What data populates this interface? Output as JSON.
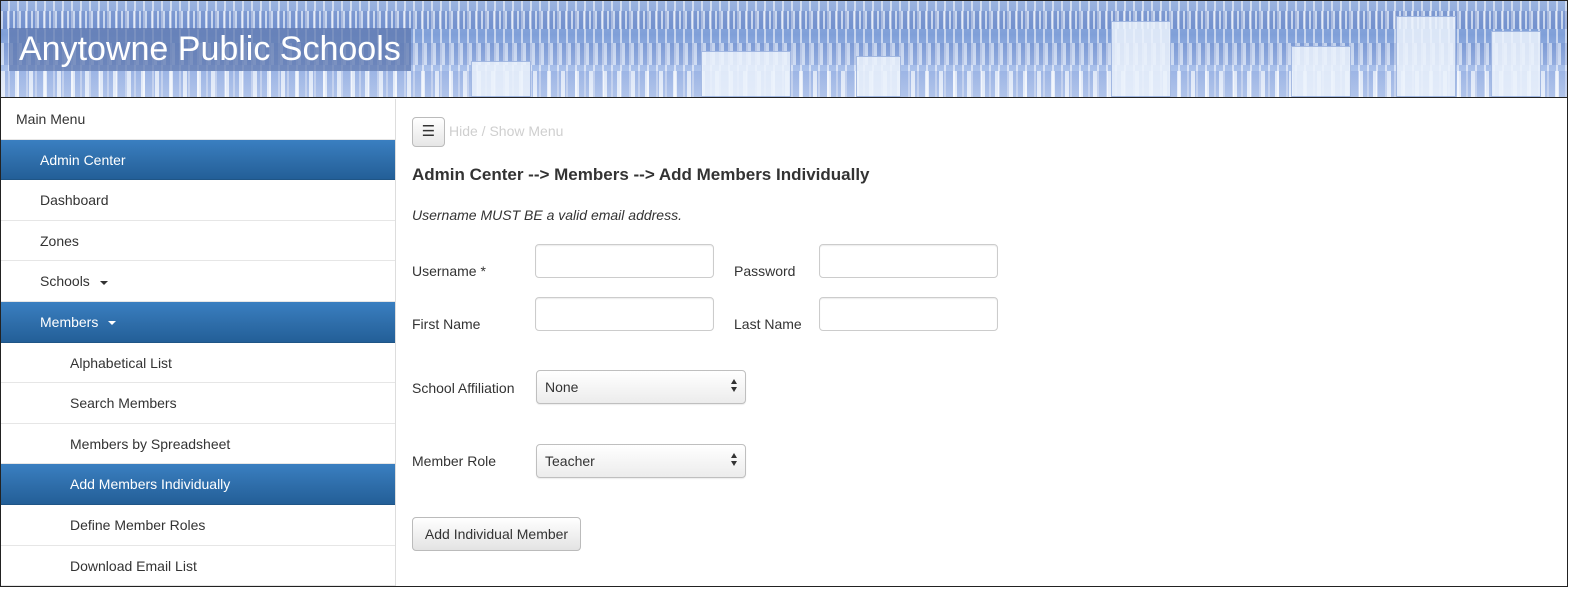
{
  "header": {
    "title": "Anytowne Public Schools"
  },
  "sidebar": {
    "items": [
      {
        "label": "Main Menu"
      },
      {
        "label": "Admin Center"
      },
      {
        "label": "Dashboard"
      },
      {
        "label": "Zones"
      },
      {
        "label": "Schools"
      },
      {
        "label": "Members"
      },
      {
        "label": "Alphabetical List"
      },
      {
        "label": "Search Members"
      },
      {
        "label": "Members by Spreadsheet"
      },
      {
        "label": "Add Members Individually"
      },
      {
        "label": "Define Member Roles"
      },
      {
        "label": "Download Email List"
      }
    ],
    "active_color": "#2e6da9"
  },
  "toolbar": {
    "toggle_icon": "☰",
    "toggle_label": "Hide / Show Menu"
  },
  "page": {
    "title": "Admin Center --> Members --> Add Members Individually",
    "note": "Username MUST BE a valid email address."
  },
  "form": {
    "username_label": "Username *",
    "username_value": "",
    "password_label": "Password",
    "password_value": "",
    "first_name_label": "First Name",
    "first_name_value": "",
    "last_name_label": "Last Name",
    "last_name_value": "",
    "school_affiliation_label": "School Affiliation",
    "school_affiliation_value": "None",
    "member_role_label": "Member Role",
    "member_role_value": "Teacher",
    "submit_label": "Add Individual Member"
  }
}
